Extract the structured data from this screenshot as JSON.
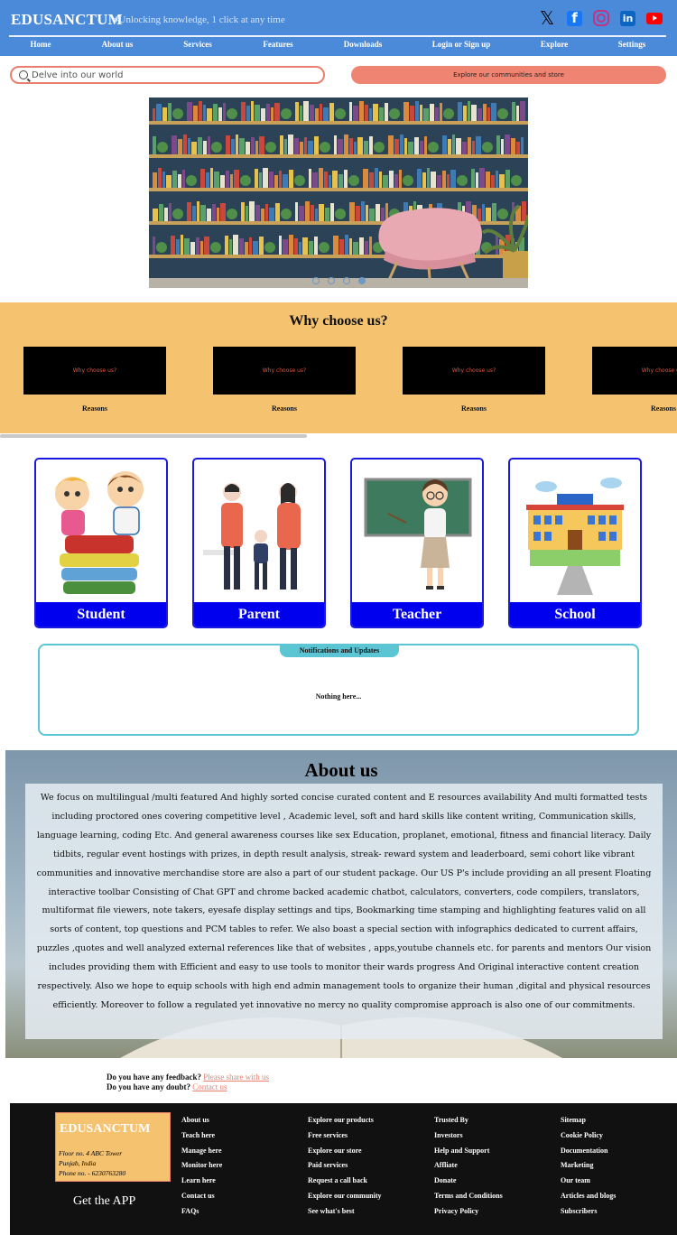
{
  "header": {
    "brand": "EDUSANCTUM",
    "tagline": "#Unlocking knowledge, 1 click at any time",
    "socials": [
      "x-icon",
      "facebook-icon",
      "instagram-icon",
      "linkedin-icon",
      "youtube-icon"
    ]
  },
  "nav": {
    "items": [
      "Home",
      "About us",
      "Services",
      "Features",
      "Downloads",
      "Login or Sign up",
      "Explore",
      "Settings"
    ]
  },
  "search": {
    "placeholder": "Delve into our world"
  },
  "explore_button": "Explore our communities and store",
  "carousel": {
    "slide_count": 4,
    "active_index": 3
  },
  "why": {
    "title": "Why choose us?",
    "cards": [
      {
        "label": "Why choose us?",
        "caption": "Reasons"
      },
      {
        "label": "Why choose us?",
        "caption": "Reasons"
      },
      {
        "label": "Why choose us?",
        "caption": "Reasons"
      },
      {
        "label": "Why choose us?",
        "caption": "Reasons"
      }
    ]
  },
  "roles": [
    "Student",
    "Parent",
    "Teacher",
    "School"
  ],
  "notifications": {
    "tab": "Notifications and Updates",
    "empty": "Nothing here..."
  },
  "about": {
    "title": "About us",
    "text": "We focus on multilingual /multi featured And highly sorted concise curated content and E resources availability And multi formatted tests including proctored ones covering competitive level , Academic level, soft and hard skills like content writing, Communication skills, language learning, coding Etc. And general awareness courses like sex Education, proplanet, emotional, fitness and financial literacy. Daily tidbits, regular event hostings with prizes, in depth result analysis, streak- reward system and leaderboard, semi cohort like vibrant communities and innovative merchandise store are also a part of our student package. Our US P's include providing an all present Floating interactive toolbar Consisting of Chat GPT and chrome backed academic chatbot, calculators, converters, code compilers, translators, multiformat file viewers, note takers, eyesafe display settings and tips, Bookmarking time stamping and highlighting features valid on all sorts of content, top questions and PCM tables to refer. We also boast a special section with infographics dedicated to current affairs, puzzles ,quotes and well analyzed external references like that of websites , apps,youtube channels etc. for parents and mentors Our vision includes providing them with Efficient and easy to use tools to monitor their wards progress And Original interactive content creation respectively. Also we hope to equip schools with high end admin management tools to organize their human ,digital and physical resources efficiently. Moreover to follow a regulated yet innovative no mercy no quality compromise approach is also one of our commitments."
  },
  "feedback": {
    "q1": "Do you have any feedback?",
    "l1": "Please share with us",
    "q2": "Do you have any doubt?",
    "l2": "Contact us"
  },
  "footer": {
    "brand": "EDUSANCTUM",
    "address": [
      "Floor no. 4 ABC Tower",
      "Punjab, India",
      "Phone no. - 6230763280"
    ],
    "get_app": "Get the APP",
    "columns": [
      [
        "About us",
        "Teach here",
        "Manage here",
        "Monitor here",
        "Learn here",
        "Contact us",
        "FAQs"
      ],
      [
        "Explore our products",
        "Free services",
        "Explore our store",
        "Paid services",
        "Request a call back",
        "Explore our community",
        "See what's best"
      ],
      [
        "Trusted By",
        "Investors",
        "Help and Support",
        "Affliate",
        "Donate",
        "Terms and Conditions",
        "Privacy Policy"
      ],
      [
        "Sitemap",
        "Cookie Policy",
        "Documentation",
        "Marketing",
        "Our team",
        "Articles and blogs",
        "Subscribers"
      ]
    ]
  }
}
